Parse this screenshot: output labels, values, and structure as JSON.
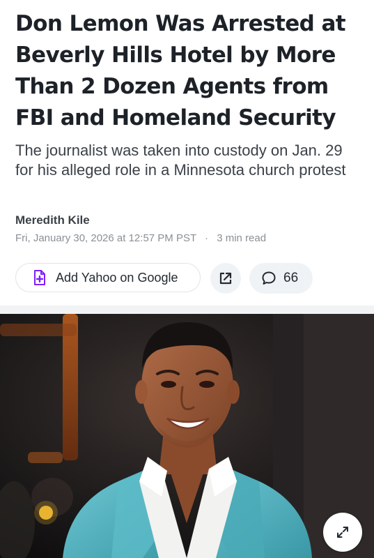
{
  "article": {
    "headline": "Don Lemon Was Arrested at Beverly Hills Hotel by More Than 2 Dozen Agents from FBI and Homeland Security",
    "subheadline": "The journalist was taken into custody on Jan. 29 for his alleged role in a Minnesota church protest",
    "author": "Meredith Kile",
    "timestamp": "Fri, January 30, 2026 at 12:57 PM PST",
    "separator": "·",
    "read_time": "3 min read"
  },
  "actions": {
    "add_google_label": "Add Yahoo on Google",
    "add_google_icon": "document-plus-icon",
    "share_icon": "external-link-icon",
    "comments_icon": "speech-bubble-icon",
    "comment_count": "66",
    "expand_icon": "expand-arrows-icon"
  },
  "colors": {
    "accent_purple": "#7e1fff",
    "headline": "#1d2228",
    "meta_gray": "#8a9096",
    "jacket_teal": "#52b7c3"
  }
}
